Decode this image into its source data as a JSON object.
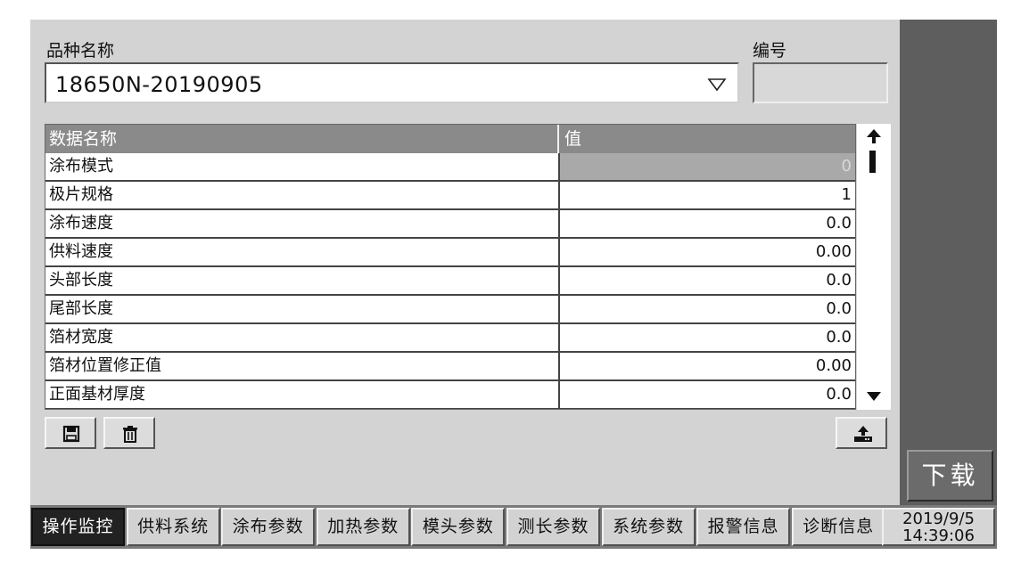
{
  "header": {
    "variety_label": "品种名称",
    "code_label": "编号",
    "variety_value": "18650N-20190905",
    "code_value": ""
  },
  "table": {
    "columns": [
      "数据名称",
      "值"
    ],
    "rows": [
      {
        "name": "涂布模式",
        "value": "0"
      },
      {
        "name": "极片规格",
        "value": "1"
      },
      {
        "name": "涂布速度",
        "value": "0.0"
      },
      {
        "name": "供料速度",
        "value": "0.00"
      },
      {
        "name": "头部长度",
        "value": "0.0"
      },
      {
        "name": "尾部长度",
        "value": "0.0"
      },
      {
        "name": "箔材宽度",
        "value": "0.0"
      },
      {
        "name": "箔材位置修正值",
        "value": "0.00"
      },
      {
        "name": "正面基材厚度",
        "value": "0.0"
      }
    ]
  },
  "toolbar": {
    "save_icon": "save-icon",
    "delete_icon": "trash-icon",
    "upload_icon": "upload-icon"
  },
  "download_label": "下载",
  "tabs": [
    "操作监控",
    "供料系统",
    "涂布参数",
    "加热参数",
    "模头参数",
    "测长参数",
    "系统参数",
    "报警信息",
    "诊断信息"
  ],
  "active_tab": 0,
  "status": {
    "date": "2019/9/5",
    "time": "14:39:06"
  }
}
